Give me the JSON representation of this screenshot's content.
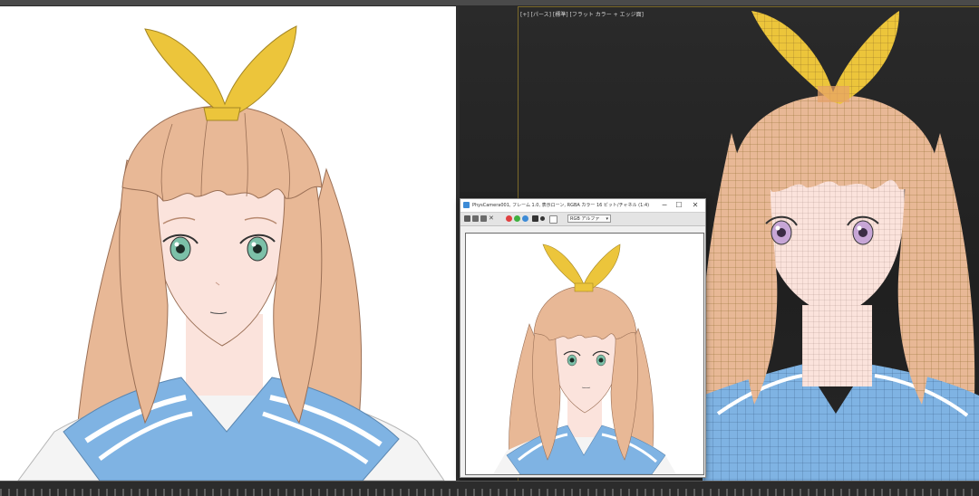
{
  "right_viewport": {
    "label": "[+] [パース] [標準] [フラット カラー + エッジ面]"
  },
  "frame_buffer": {
    "title": "PhysCamera001, フレーム 1.0, 表示ローン, RGBA カラー 16 ビット/チャネル (1:4)",
    "minimize": "─",
    "maximize": "☐",
    "close": "✕",
    "channel_dropdown": "RGB アルファ"
  },
  "colors": {
    "hair": "#e8b896",
    "hair_line": "#9a6f55",
    "skin": "#fbe3dc",
    "ribbon": "#ecc53b",
    "ribbon_line": "#a48624",
    "collar": "#7fb3e3",
    "collar_stripe": "#ffffff",
    "shirt": "#f4f4f4",
    "eye_iris": "#7cc0a8",
    "eye_iris_3d": "#c7a6d6",
    "wire": "#8a6a28",
    "viewport_bg": "#222222",
    "accent_icon": "#3d8bd6"
  },
  "icons": [
    "app-icon",
    "save-icon",
    "copy-icon",
    "clone-icon",
    "clear-icon",
    "red-channel-icon",
    "green-channel-icon",
    "blue-channel-icon",
    "alpha-channel-icon",
    "mono-icon",
    "swatch-icon"
  ]
}
